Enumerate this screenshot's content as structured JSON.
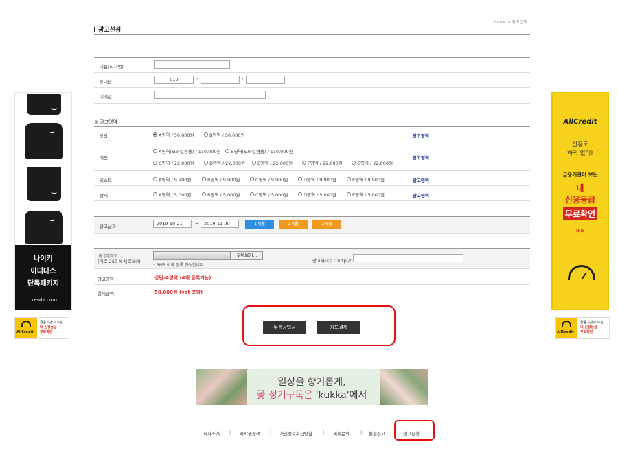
{
  "header": {
    "title": "광고신청",
    "breadcrumb": "Home > 광고신청"
  },
  "contact": {
    "name_label": "이름(회사명)",
    "name_value": "",
    "phone_label": "휴대폰",
    "phone_1": "010",
    "phone_2": "",
    "phone_3": "",
    "phone_sep": "-",
    "email_label": "이메일",
    "email_value": ""
  },
  "ad_area": {
    "section_title": "※ 광고영역",
    "link_label": "광고영역",
    "rows": [
      {
        "label": "상단",
        "options": [
          "A영역 / 50,000원",
          "B영역 / 50,000원"
        ]
      },
      {
        "label": "메인",
        "options": [
          "A영역(모바일겸용) / 110,000원",
          "B영역(모바일겸용) / 110,000원",
          "C영역 / 22,000원",
          "D영역 / 22,000원",
          "E영역 / 22,000원",
          "F영역 / 22,000원",
          "G영역 / 22,000원"
        ]
      },
      {
        "label": "리스트",
        "options": [
          "A영역 / 9,900원",
          "B영역 / 9,900원",
          "C영역 / 9,900원",
          "D영역 / 9,900원",
          "E영역 / 9,900원"
        ]
      },
      {
        "label": "상세",
        "options": [
          "A영역 / 5,000원",
          "B영역 / 5,000원",
          "C영역 / 5,000원",
          "D영역 / 5,000원",
          "E영역 / 5,000원"
        ]
      }
    ]
  },
  "dates": {
    "label": "광고날짜",
    "start": "2019-10-21",
    "sep": "~",
    "end": "2019-11-20",
    "buttons": [
      "1개월",
      "2개월",
      "3개월"
    ],
    "colors": {
      "blue": "#2f8fe0",
      "orange": "#f29a1f"
    }
  },
  "banner": {
    "label_line1": "배너이미지",
    "label_line2": "(가로:260 X 세로:60)",
    "find_button": "찾아보기...",
    "note": "* 3MB 이하 등록 가능합니다.",
    "site_label": "광고사이트 : http://",
    "site_value": ""
  },
  "summary": {
    "area_label": "광고영역",
    "area_value": "상단-A영역 (4개 등록가능)",
    "amount_label": "결제금액",
    "amount_value": "50,000원 (vat 포함)",
    "accent_color": "#dd3333"
  },
  "actions": {
    "bank_button": "무통장입금",
    "card_button": "카드결제",
    "highlight_color": "#e51010"
  },
  "left_ad": {
    "lines": [
      "나이키",
      "아디다스",
      "단독패키지"
    ],
    "url": "crewbi.com"
  },
  "right_ad": {
    "brand": "AllCredit",
    "sub1": "신용도",
    "sub2": "하락 없이!",
    "line1": "금융기관이 보는",
    "line2": "내",
    "line3": "신용등급",
    "line4": "무료확인",
    "chevrons": "»»"
  },
  "mini_ad": {
    "brand": "AllCredit",
    "line1": "금융기관이 보는",
    "line2": "내 신용등급",
    "line3": "무료확인"
  },
  "flower_ad": {
    "line1": "일상을 향기롭게,",
    "line2_a": "꽃 정기구독은",
    "line2_b": " 'kukka'에서"
  },
  "footer": {
    "items": [
      "회사소개",
      "저작권정책",
      "개인정보취급방침",
      "제휴문의",
      "불편신고",
      "광고신청"
    ],
    "sep": "|"
  }
}
